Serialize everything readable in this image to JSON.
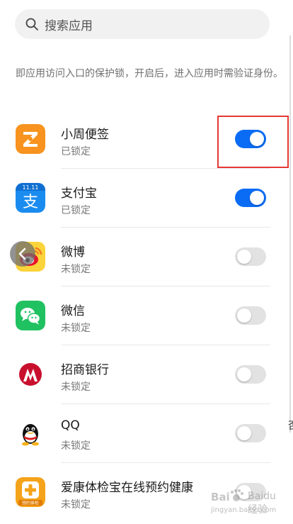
{
  "search": {
    "placeholder": "搜索应用",
    "icon": "search-icon"
  },
  "description": "即应用访问入口的保护锁，开启后，进入应用时需验证身份。",
  "apps": [
    {
      "name": "小周便签",
      "status": "已锁定",
      "locked": true,
      "icon": "xiaozhou-notes-icon",
      "icon_color": "#f7931e"
    },
    {
      "name": "支付宝",
      "status": "已锁定",
      "locked": true,
      "icon": "alipay-icon",
      "icon_color": "#1a8cf0"
    },
    {
      "name": "微博",
      "status": "未锁定",
      "locked": false,
      "icon": "weibo-icon",
      "icon_color": "#e6162d"
    },
    {
      "name": "微信",
      "status": "未锁定",
      "locked": false,
      "icon": "wechat-icon",
      "icon_color": "#20c160"
    },
    {
      "name": "招商银行",
      "status": "未锁定",
      "locked": false,
      "icon": "cmb-icon",
      "icon_color": "#c8102e"
    },
    {
      "name": "QQ",
      "status": "未锁定",
      "locked": false,
      "icon": "qq-icon",
      "icon_color": "#111111"
    },
    {
      "name": "爱康体检宝在线预约健康",
      "status": "未锁定",
      "locked": false,
      "icon": "ikang-icon",
      "icon_color": "#f5a31a"
    }
  ],
  "icon_labels": {
    "alipay_top": "11.11",
    "ikang_banner": "预约体检"
  },
  "edge_fragment": "否",
  "watermark": {
    "brand": "Baidu 经验",
    "url": "jingyan.baidu.com"
  },
  "colors": {
    "toggle_on": "#0a6cf5",
    "toggle_off": "#e2e2e2",
    "highlight": "#e53935"
  }
}
